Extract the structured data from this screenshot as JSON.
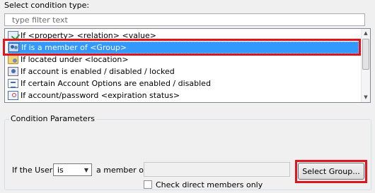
{
  "heading": "Select condition type:",
  "filter": {
    "placeholder": "type filter text",
    "value": ""
  },
  "conditions": [
    {
      "label": "If <property> <relation> <value>",
      "icon": "property-condition-icon",
      "selected": false
    },
    {
      "label": "If is a member of <Group>",
      "icon": "group-membership-icon",
      "selected": true
    },
    {
      "label": "If located under <location>",
      "icon": "location-folder-icon",
      "selected": false
    },
    {
      "label": "If account is enabled / disabled / locked",
      "icon": "account-status-icon",
      "selected": false
    },
    {
      "label": "If certain Account Options are enabled / disabled",
      "icon": "account-options-icon",
      "selected": false
    },
    {
      "label": "If account/password <expiration status>",
      "icon": "expiration-clock-icon",
      "selected": false
    }
  ],
  "params": {
    "title": "Condition Parameters",
    "if_user_label": "If the User",
    "relation": {
      "selected": "is"
    },
    "member_label": "a member of",
    "group_value": "",
    "select_group_button": "Select Group...",
    "check_direct_label": "Check direct members only",
    "check_direct_checked": false
  },
  "colors": {
    "selection": "#3399ff",
    "highlight": "#e0141e"
  }
}
